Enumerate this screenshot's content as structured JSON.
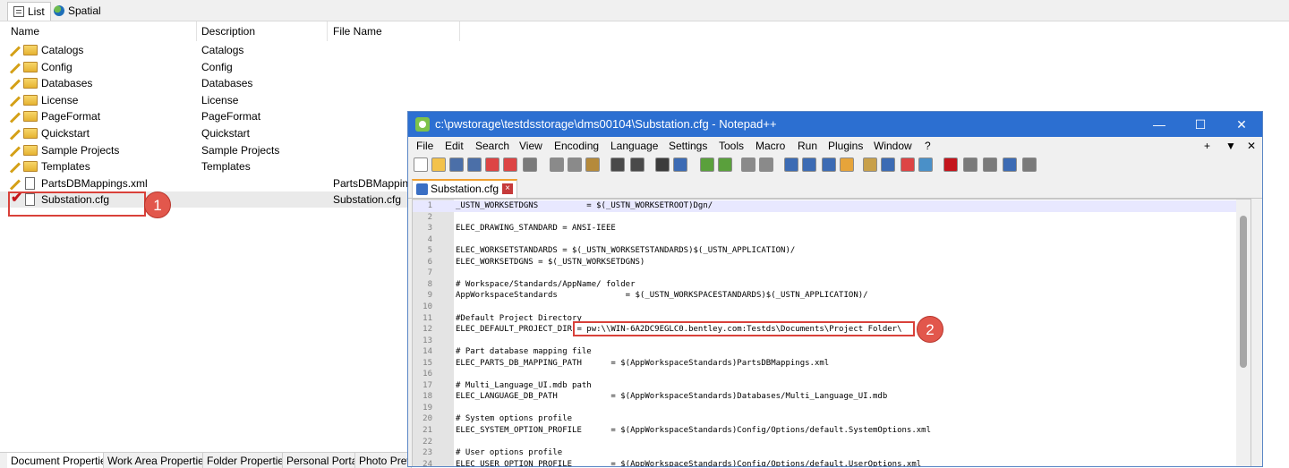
{
  "explorer": {
    "tabs": [
      {
        "label": "List",
        "icon": "list-icon"
      },
      {
        "label": "Spatial",
        "icon": "globe-icon"
      }
    ],
    "columns": [
      "Name",
      "Description",
      "File Name"
    ],
    "rows": [
      {
        "name": "Catalogs",
        "description": "Catalogs",
        "file_name": "",
        "kind": "folder"
      },
      {
        "name": "Config",
        "description": "Config",
        "file_name": "",
        "kind": "folder"
      },
      {
        "name": "Databases",
        "description": "Databases",
        "file_name": "",
        "kind": "folder"
      },
      {
        "name": "License",
        "description": "License",
        "file_name": "",
        "kind": "folder"
      },
      {
        "name": "PageFormat",
        "description": "PageFormat",
        "file_name": "",
        "kind": "folder"
      },
      {
        "name": "Quickstart",
        "description": "Quickstart",
        "file_name": "",
        "kind": "folder"
      },
      {
        "name": "Sample Projects",
        "description": "Sample Projects",
        "file_name": "",
        "kind": "folder"
      },
      {
        "name": "Templates",
        "description": "Templates",
        "file_name": "",
        "kind": "folder"
      },
      {
        "name": "PartsDBMappings.xml",
        "description": "",
        "file_name": "PartsDBMappings.xml",
        "kind": "file"
      },
      {
        "name": "Substation.cfg",
        "description": "",
        "file_name": "Substation.cfg",
        "kind": "file-checked"
      }
    ],
    "bottom_tabs": [
      "Document Properties",
      "Work Area Properties",
      "Folder Properties",
      "Personal Portal",
      "Photo Previ"
    ]
  },
  "callouts": [
    "1",
    "2"
  ],
  "notepad": {
    "title": "c:\\pwstorage\\testdsstorage\\dms00104\\Substation.cfg - Notepad++",
    "window_buttons": {
      "minimize": "—",
      "maximize": "☐",
      "close": "✕"
    },
    "menu": [
      "File",
      "Edit",
      "Search",
      "View",
      "Encoding",
      "Language",
      "Settings",
      "Tools",
      "Macro",
      "Run",
      "Plugins",
      "Window",
      "?"
    ],
    "menu_right": [
      "+",
      "▼",
      "✕"
    ],
    "file_tab": "Substation.cfg",
    "lines": [
      {
        "n": "1",
        "text": "_USTN_WORKSETDGNS          = $(_USTN_WORKSETROOT)Dgn/"
      },
      {
        "n": "2",
        "text": ""
      },
      {
        "n": "3",
        "text": "ELEC_DRAWING_STANDARD = ANSI-IEEE"
      },
      {
        "n": "4",
        "text": ""
      },
      {
        "n": "5",
        "text": "ELEC_WORKSETSTANDARDS = $(_USTN_WORKSETSTANDARDS)$(_USTN_APPLICATION)/"
      },
      {
        "n": "6",
        "text": "ELEC_WORKSETDGNS = $(_USTN_WORKSETDGNS)"
      },
      {
        "n": "7",
        "text": ""
      },
      {
        "n": "8",
        "text": "# Workspace/Standards/AppName/ folder"
      },
      {
        "n": "9",
        "text": "AppWorkspaceStandards              = $(_USTN_WORKSPACESTANDARDS)$(_USTN_APPLICATION)/"
      },
      {
        "n": "10",
        "text": ""
      },
      {
        "n": "11",
        "text": "#Default Project Directory"
      },
      {
        "n": "12",
        "text": "ELEC_DEFAULT_PROJECT_DIR = pw:\\\\WIN-6A2DC9EGLC0.bentley.com:Testds\\Documents\\Project Folder\\"
      },
      {
        "n": "13",
        "text": ""
      },
      {
        "n": "14",
        "text": "# Part database mapping file"
      },
      {
        "n": "15",
        "text": "ELEC_PARTS_DB_MAPPING_PATH      = $(AppWorkspaceStandards)PartsDBMappings.xml"
      },
      {
        "n": "16",
        "text": ""
      },
      {
        "n": "17",
        "text": "# Multi_Language_UI.mdb path"
      },
      {
        "n": "18",
        "text": "ELEC_LANGUAGE_DB_PATH           = $(AppWorkspaceStandards)Databases/Multi_Language_UI.mdb"
      },
      {
        "n": "19",
        "text": ""
      },
      {
        "n": "20",
        "text": "# System options profile"
      },
      {
        "n": "21",
        "text": "ELEC_SYSTEM_OPTION_PROFILE      = $(AppWorkspaceStandards)Config/Options/default.SystemOptions.xml"
      },
      {
        "n": "22",
        "text": ""
      },
      {
        "n": "23",
        "text": "# User options profile"
      },
      {
        "n": "24",
        "text": "ELEC_USER_OPTION_PROFILE        = $(AppWorkspaceStandards)Config/Options/default.UserOptions.xml"
      }
    ]
  },
  "colors": {
    "titlebar": "#2c6fd1",
    "callout": "#e2574c",
    "callout_border": "#d9413a"
  }
}
